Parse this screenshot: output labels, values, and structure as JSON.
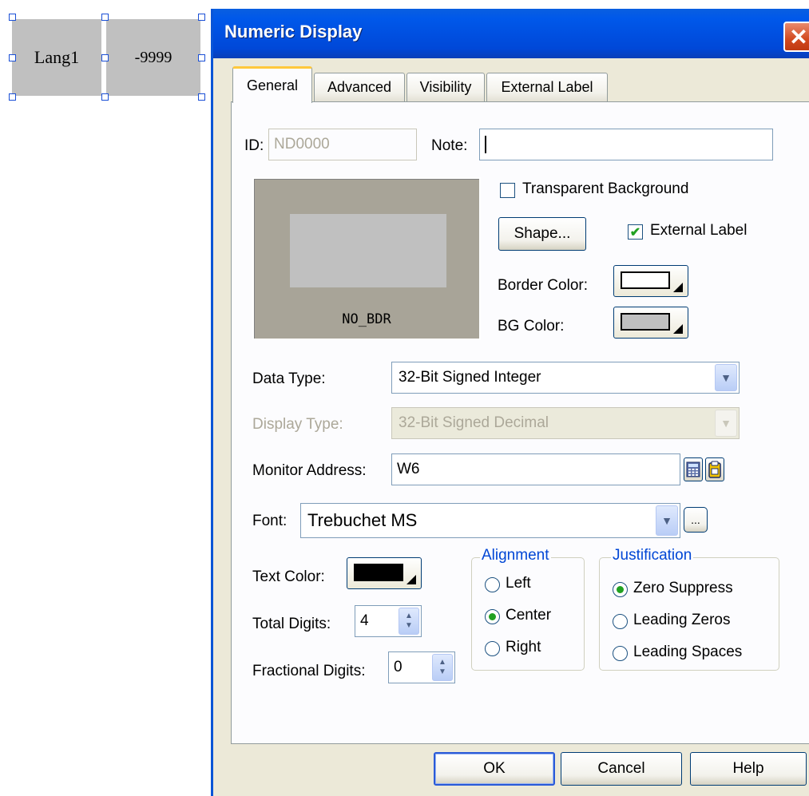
{
  "canvas": {
    "label_text": "Lang1",
    "value_text": "-9999"
  },
  "dialog": {
    "title": "Numeric Display",
    "close_glyph": "✕",
    "tabs": [
      {
        "label": "General",
        "active": true
      },
      {
        "label": "Advanced",
        "active": false
      },
      {
        "label": "Visibility",
        "active": false
      },
      {
        "label": "External Label",
        "active": false
      }
    ],
    "general": {
      "id_label": "ID:",
      "id_value": "ND0000",
      "note_label": "Note:",
      "note_value": "",
      "preview_caption": "NO_BDR",
      "transparent_bg_label": "Transparent Background",
      "transparent_bg_checked": false,
      "shape_button": "Shape...",
      "external_label_label": "External Label",
      "external_label_checked": true,
      "border_color_label": "Border Color:",
      "border_color": "#ffffff",
      "bg_color_label": "BG Color:",
      "bg_color": "#c0c0c0",
      "data_type_label": "Data Type:",
      "data_type_value": "32-Bit Signed Integer",
      "display_type_label": "Display Type:",
      "display_type_value": "32-Bit Signed Decimal",
      "monitor_address_label": "Monitor Address:",
      "monitor_address_value": "W6",
      "font_label": "Font:",
      "font_value": "Trebuchet MS",
      "font_more_button": "...",
      "text_color_label": "Text Color:",
      "text_color": "#000000",
      "total_digits_label": "Total Digits:",
      "total_digits_value": "4",
      "fractional_digits_label": "Fractional Digits:",
      "fractional_digits_value": "0",
      "alignment": {
        "title": "Alignment",
        "options": [
          "Left",
          "Center",
          "Right"
        ],
        "selected": "Center"
      },
      "justification": {
        "title": "Justification",
        "options": [
          "Zero Suppress",
          "Leading Zeros",
          "Leading Spaces"
        ],
        "selected": "Zero Suppress"
      }
    },
    "buttons": {
      "ok": "OK",
      "cancel": "Cancel",
      "help": "Help"
    }
  }
}
